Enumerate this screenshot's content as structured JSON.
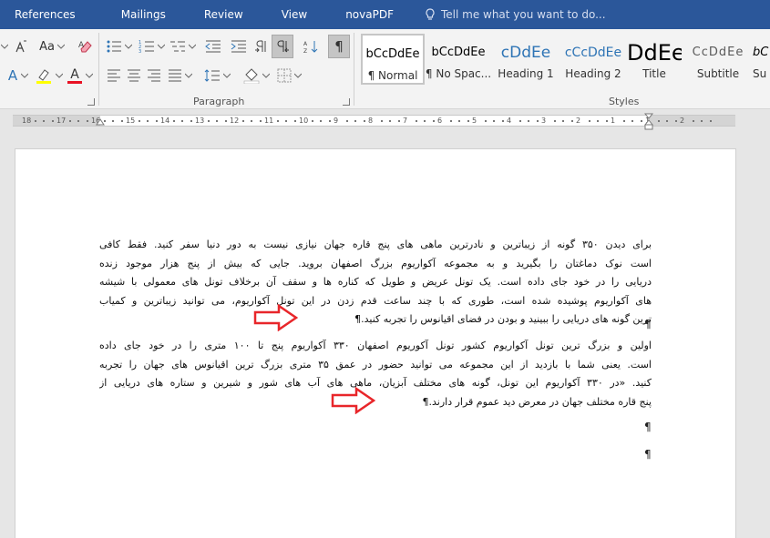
{
  "menu": {
    "tabs": [
      "References",
      "Mailings",
      "Review",
      "View",
      "novaPDF"
    ],
    "tell_me": "Tell me what you want to do..."
  },
  "ribbon": {
    "font_group": {
      "change_case_label": "Aa",
      "font_color_label": "A",
      "text_effects_label": "A"
    },
    "paragraph_group_label": "Paragraph",
    "styles_group_label": "Styles",
    "styles": [
      {
        "preview": "bCcDdEe",
        "label": "¶ Normal",
        "color": "#000000",
        "selected": true
      },
      {
        "preview": "bCcDdEe",
        "label": "¶ No Spac...",
        "color": "#000000",
        "selected": false
      },
      {
        "preview": "cDdEe",
        "label": "Heading 1",
        "color": "#2e74b5",
        "selected": false
      },
      {
        "preview": "cCcDdEe",
        "label": "Heading 2",
        "color": "#2e74b5",
        "selected": false
      },
      {
        "preview": "DdEe",
        "label": "Title",
        "color": "#000000",
        "selected": false
      },
      {
        "preview": "CcDdEe",
        "label": "Subtitle",
        "color": "#5a5a5a",
        "selected": false
      },
      {
        "preview": "bC",
        "label": "Su",
        "color": "#000000",
        "selected": false
      }
    ]
  },
  "ruler": {
    "numbers": [
      "18",
      "17",
      "16",
      "15",
      "14",
      "13",
      "12",
      "11",
      "10",
      "9",
      "8",
      "7",
      "6",
      "5",
      "4",
      "3",
      "2",
      "1",
      "1",
      "2"
    ]
  },
  "document": {
    "paragraph1_lines": [
      "برای دیدن ۳۵۰ گونه از زیباترین و نادرترین ماهی های پنج قاره جهان نیازی نیست به دور دنیا سفر کنید. فقط کافی",
      "است نوک دماغتان را بگیرید و به مجموعه آکواریوم بزرگ اصفهان بروید. جایی که بیش از پنج هزار موجود زنده",
      "دریایی را در خود جای داده است. یک تونل عریض و طویل که کناره ها و سقف آن برخلاف تونل های معمولی با شیشه",
      "های آکواریوم پوشیده شده است، طوری که با چند ساعت قدم زدن در این تونل آکواریوم، می توانید زیباترین و کمیاب",
      "ترین گونه های دریایی را ببینید و بودن در فضای اقیانوس را تجربه کنید.¶"
    ],
    "paragraph2_lines": [
      "اولین و بزرگ ترین تونل آکواریوم کشور تونل آکوریوم اصفهان ۳۳۰ آکواریوم پنج تا ۱۰۰ متری را در خود جای داده",
      "است. یعنی شما با بازدید از این مجموعه می توانید حضور در عمق ۳۵ متری بزرگ ترین اقیانوس های جهان را تجربه",
      "کنید. «در ۳۳۰ آکواریوم این تونل، گونه های مختلف آبزیان، ماهی های آب های شور و شیرین و ستاره های دریایی از",
      "پنج قاره مختلف جهان در معرض دید عموم قرار دارند.¶"
    ],
    "pilcrow": "¶"
  },
  "colors": {
    "menu_bar": "#2b579a",
    "arrow": "#e8262a",
    "heading_blue": "#2e74b5"
  }
}
